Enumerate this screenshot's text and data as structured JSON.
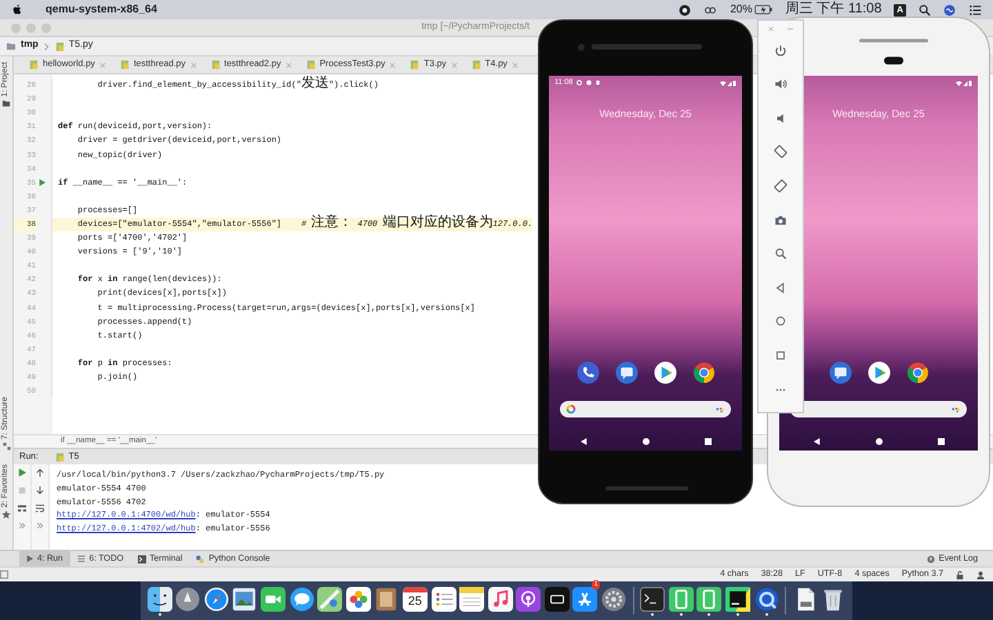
{
  "menu_bar": {
    "app_name": "qemu-system-x86_64",
    "battery": "20%",
    "clock": "周三 下午 11:08",
    "input_source": "A"
  },
  "ide": {
    "title": "tmp [~/PycharmProjects/t",
    "breadcrumb": [
      "tmp",
      "T5.py"
    ],
    "side_tools": [
      {
        "label": "1: Project",
        "kind": "project"
      },
      {
        "label": "7: Structure",
        "kind": "structure"
      },
      {
        "label": "2: Favorites",
        "kind": "favorites"
      }
    ],
    "tabs": [
      "helloworld.py",
      "testthread.py",
      "testthread2.py",
      "ProcessTest3.py",
      "T3.py",
      "T4.py"
    ],
    "code_lines": [
      {
        "number": "28",
        "text": "        driver.find_element_by_accessibility_id(\"发送\").click()",
        "current": false,
        "run_marker": false
      },
      {
        "number": "29",
        "current": false,
        "run_marker": false
      },
      {
        "number": "30",
        "current": false,
        "run_marker": false
      },
      {
        "number": "31",
        "text": "**def** run(deviceid,port,version):",
        "current": false,
        "run_marker": false
      },
      {
        "number": "32",
        "text": "    driver = getdriver(deviceid,port,version)",
        "current": false,
        "run_marker": false
      },
      {
        "number": "33",
        "text": "    new_topic(driver)",
        "current": false,
        "run_marker": false
      },
      {
        "number": "34",
        "current": false,
        "run_marker": false
      },
      {
        "number": "35",
        "text": "**if** __name__ == '__main__':",
        "current": false,
        "run_marker": true
      },
      {
        "number": "36",
        "current": false,
        "run_marker": false
      },
      {
        "number": "37",
        "text": "    processes=[]",
        "current": false,
        "run_marker": false
      },
      {
        "number": "38",
        "text": "    devices=[\"emulator-5554\",\"emulator-5556\"]    *# 注意： 4700 端口对应的设备为127.0.0.*",
        "current": true,
        "run_marker": false
      },
      {
        "number": "39",
        "text": "    ports =['4700','4702']",
        "current": false,
        "run_marker": false
      },
      {
        "number": "40",
        "text": "    versions = ['9','10']",
        "current": false,
        "run_marker": false
      },
      {
        "number": "41",
        "current": false,
        "run_marker": false
      },
      {
        "number": "42",
        "text": "    **for** x **in** range(len(devices)):",
        "current": false,
        "run_marker": false
      },
      {
        "number": "43",
        "text": "        print(devices[x],ports[x])",
        "current": false,
        "run_marker": false
      },
      {
        "number": "44",
        "text": "        t = multiprocessing.Process(target=run,args=(devices[x],ports[x],versions[x]",
        "current": false,
        "run_marker": false
      },
      {
        "number": "45",
        "text": "        processes.append(t)",
        "current": false,
        "run_marker": false
      },
      {
        "number": "46",
        "text": "        t.start()",
        "current": false,
        "run_marker": false
      },
      {
        "number": "47",
        "current": false,
        "run_marker": false
      },
      {
        "number": "48",
        "text": "    **for** p **in** processes:",
        "current": false,
        "run_marker": false
      },
      {
        "number": "49",
        "text": "        p.join()",
        "current": false,
        "run_marker": false
      },
      {
        "number": "50",
        "current": false,
        "run_marker": false
      }
    ],
    "editor_breadcrumb": "if __name__ == '__main__'",
    "run_panel": {
      "label": "Run:",
      "tab": "T5",
      "output": [
        {
          "text": "/usr/local/bin/python3.7 /Users/zackzhao/PycharmProjects/tmp/T5.py"
        },
        {
          "text": "emulator-5554 4700"
        },
        {
          "text": "emulator-5556 4702"
        },
        {
          "link": "http://127.0.0.1:4700/wd/hub",
          "text": ": emulator-5554"
        },
        {
          "link": "http://127.0.0.1:4702/wd/hub",
          "text": ": emulator-5556"
        }
      ]
    },
    "tool_tabs": [
      {
        "label": "4: Run",
        "kind": "run",
        "selected": true
      },
      {
        "label": "6: TODO",
        "kind": "todo",
        "selected": false
      },
      {
        "label": "Terminal",
        "kind": "terminal",
        "selected": false
      },
      {
        "label": "Python Console",
        "kind": "console",
        "selected": false
      }
    ],
    "event_log": "Event Log",
    "status_bar": [
      "4 chars",
      "38:28",
      "LF",
      "UTF-8",
      "4 spaces",
      "Python 3.7"
    ]
  },
  "emulators": [
    {
      "kind": "dark",
      "status_time": "11:08",
      "date": "Wednesday, Dec 25",
      "google_logo": true,
      "apps": [
        {
          "kind": "phone"
        },
        {
          "kind": "messages"
        },
        {
          "kind": "play_store"
        },
        {
          "kind": "chrome"
        }
      ]
    },
    {
      "kind": "light",
      "date": "Wednesday, Dec 25",
      "google_logo": false,
      "apps": [
        {
          "kind": "messages"
        },
        {
          "kind": "play_store"
        },
        {
          "kind": "chrome"
        }
      ]
    }
  ],
  "dock": [
    {
      "kind": "finder",
      "running": true
    },
    {
      "kind": "launchpad",
      "running": false
    },
    {
      "kind": "safari",
      "running": false
    },
    {
      "kind": "preview",
      "running": false
    },
    {
      "kind": "facetime",
      "running": false
    },
    {
      "kind": "messages",
      "running": false
    },
    {
      "kind": "maps",
      "running": false
    },
    {
      "kind": "photos",
      "running": false
    },
    {
      "kind": "contacts",
      "running": false
    },
    {
      "kind": "calendar",
      "day": "25",
      "running": false
    },
    {
      "kind": "reminders",
      "running": false
    },
    {
      "kind": "notes",
      "running": false
    },
    {
      "kind": "music",
      "running": false
    },
    {
      "kind": "podcasts",
      "running": false
    },
    {
      "kind": "tv",
      "running": false
    },
    {
      "kind": "app_store",
      "badge": "1",
      "running": false
    },
    {
      "kind": "system_preferences",
      "running": false
    },
    {
      "kind": "separator"
    },
    {
      "kind": "terminal",
      "running": true
    },
    {
      "kind": "green_app",
      "running": true
    },
    {
      "kind": "green_app",
      "running": true
    },
    {
      "kind": "pycharm",
      "running": true
    },
    {
      "kind": "quicktime",
      "running": true
    },
    {
      "kind": "separator"
    },
    {
      "kind": "document",
      "running": false
    },
    {
      "kind": "trash",
      "running": false
    }
  ]
}
